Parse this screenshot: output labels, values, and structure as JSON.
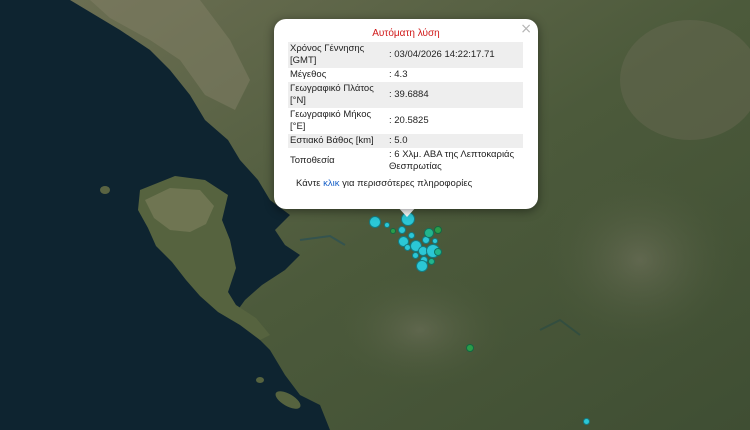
{
  "popup": {
    "title": "Αυτόματη λύση",
    "close_symbol": "×",
    "rows": [
      {
        "label": "Χρόνος Γέννησης [GMT]",
        "value": ": 03/04/2026 14:22:17.71"
      },
      {
        "label": "Μέγεθος",
        "value": ": 4.3"
      },
      {
        "label": "Γεωγραφικό Πλάτος [°N]",
        "value": ": 39.6884"
      },
      {
        "label": "Γεωγραφικό Μήκος [°E]",
        "value": ": 20.5825"
      },
      {
        "label": "Εστιακό Βάθος [km]",
        "value": ": 5.0"
      },
      {
        "label": "Τοποθεσία",
        "value": ": 6 Χλμ. ΑΒΑ της Λεπτοκαριάς Θεσπρωτίας"
      }
    ],
    "more_prefix": "Κάντε",
    "more_link": "κλικ",
    "more_suffix": "για περισσότερες πληροφορίες"
  },
  "colors": {
    "sea": "#0e2430",
    "land": "#4d5a3e",
    "popup_title": "#d01818",
    "link": "#1a62c8",
    "quake_recent": "#2bc7d6",
    "quake_older": "#2a9d4a"
  }
}
